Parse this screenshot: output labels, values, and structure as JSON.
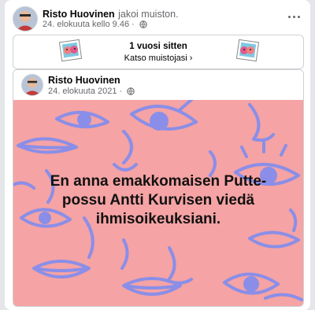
{
  "post": {
    "author": "Risto Huovinen",
    "action": "jakoi muiston.",
    "timestamp": "24. elokuuta kello 9.46",
    "privacy_icon": "globe-icon",
    "more_icon": "more-horizontal-icon"
  },
  "memory": {
    "title": "1 vuosi sitten",
    "link": "Katso muistojasi",
    "link_icon": "chevron-right-icon"
  },
  "shared_post": {
    "author": "Risto Huovinen",
    "date": "24. elokuuta 2021",
    "privacy_icon": "globe-icon",
    "image_text": "En anna emakkomaisen Putte-possu Antti Kurvisen viedä ihmisoikeuksiani."
  },
  "colors": {
    "image_background": "#f5a3a4",
    "image_line_art": "#8a8ee8",
    "meta_text": "#65676b"
  }
}
